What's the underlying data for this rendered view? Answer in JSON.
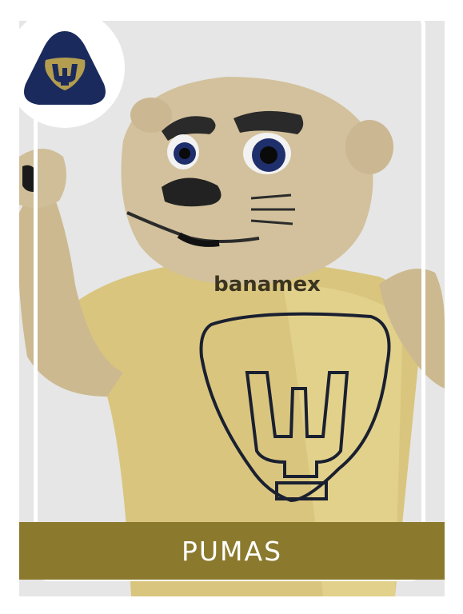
{
  "team": {
    "name": "PUMAS",
    "sponsor_text": "banamex"
  },
  "colors": {
    "navy": "#1b2a5c",
    "gold": "#8b7a2d",
    "shirt": "#d8c27a",
    "background": "#e6e6e6"
  },
  "badge": {
    "icon": "pumas-crest-icon"
  },
  "photo": {
    "subject": "mascot-photo"
  }
}
